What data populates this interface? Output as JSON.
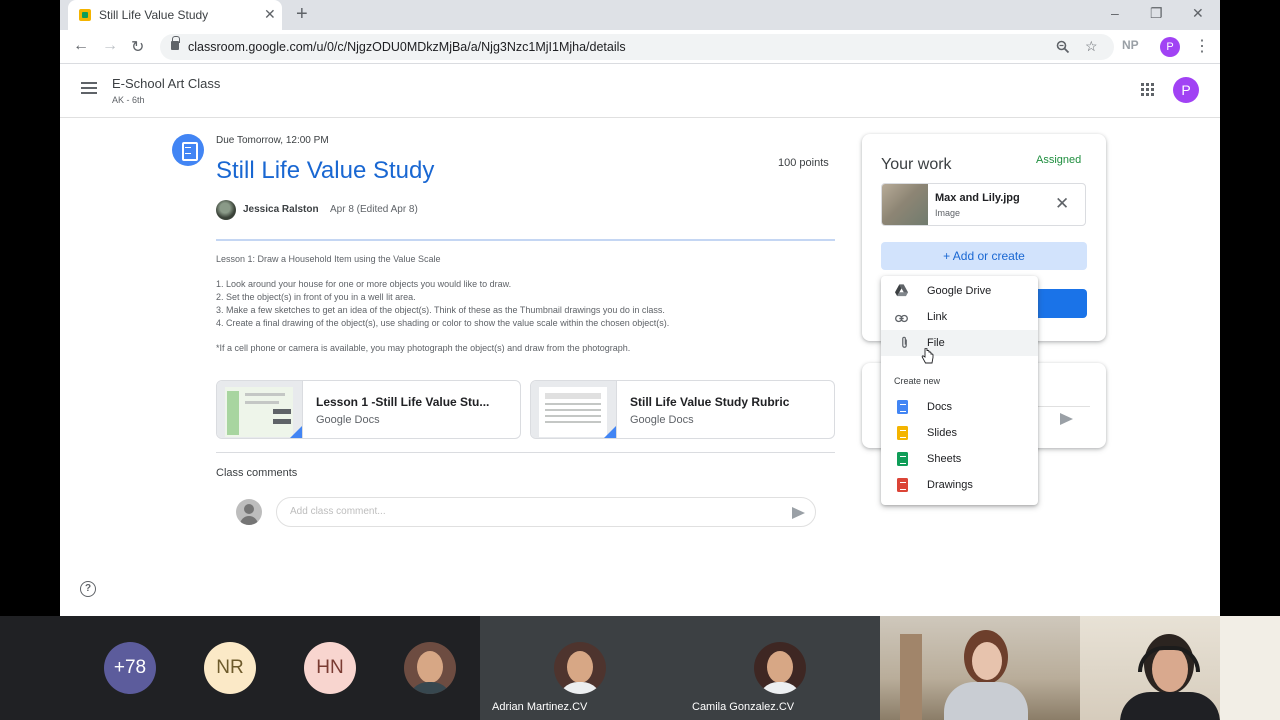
{
  "browser": {
    "tab_title": "Still Life Value Study",
    "tab_close": "✕",
    "new_tab": "+",
    "url": "classroom.google.com/u/0/c/NjgzODU0MDkzMjBa/a/Njg3Nzc1MjI1Mjha/details",
    "ext_label": "NP",
    "profile_initial": "P"
  },
  "app": {
    "class_name": "E-School Art Class",
    "class_section": "AK - 6th",
    "profile_initial": "P"
  },
  "assignment": {
    "due": "Due Tomorrow, 12:00 PM",
    "title": "Still Life Value Study",
    "points": "100 points",
    "author": "Jessica Ralston",
    "date": "Apr 8 (Edited Apr 8)",
    "description": [
      "Lesson 1: Draw a Household Item using the Value Scale",
      "1. Look around your house for one or more objects you would like to draw.",
      "2. Set the object(s) in front of you in a well lit area.",
      "3. Make a few sketches to get an idea of the object(s). Think of these as the Thumbnail drawings you do in class.",
      "4. Create a final drawing of the object(s), use shading or color to show the value scale within the chosen object(s).",
      "*If a cell phone or camera is available, you may photograph the object(s) and draw from the photograph."
    ],
    "attachments": [
      {
        "title": "Lesson 1 -Still Life Value Stu...",
        "type": "Google Docs"
      },
      {
        "title": "Still Life Value Study Rubric",
        "type": "Google Docs"
      }
    ],
    "comments_heading": "Class comments",
    "comment_placeholder": "Add class comment..."
  },
  "your_work": {
    "title": "Your work",
    "status": "Assigned",
    "file_name": "Max and Lily.jpg",
    "file_type": "Image",
    "remove_icon": "✕",
    "add_label": "+ Add or create"
  },
  "menu": {
    "items": [
      {
        "label": "Google Drive",
        "icon": "google-drive-icon"
      },
      {
        "label": "Link",
        "icon": "link-icon"
      },
      {
        "label": "File",
        "icon": "paperclip-icon"
      }
    ],
    "create_new": "Create new",
    "create_items": [
      {
        "label": "Docs",
        "color": "#4285f4"
      },
      {
        "label": "Slides",
        "color": "#f4b400"
      },
      {
        "label": "Sheets",
        "color": "#0f9d58"
      },
      {
        "label": "Drawings",
        "color": "#db4437"
      }
    ]
  },
  "meet": {
    "overflow_count": "+78",
    "initials": [
      "NR",
      "HN"
    ],
    "names": [
      "Adrian Martinez.CV",
      "Camila Gonzalez.CV"
    ]
  },
  "help_glyph": "?"
}
